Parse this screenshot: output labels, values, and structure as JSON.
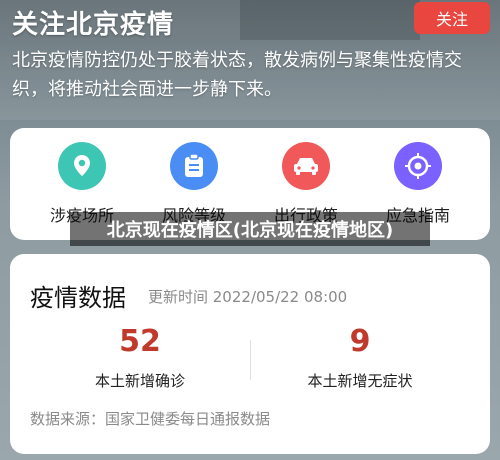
{
  "header": {
    "title": "关注北京疫情",
    "follow_button": "关注",
    "description": "北京疫情防控仍处于胶着状态，散发病例与聚集性疫情交织，将推动社会面进一步静下来。"
  },
  "quick_links": [
    {
      "label": "涉疫场所",
      "icon": "location-pin-icon",
      "color": "#3ec6b4"
    },
    {
      "label": "风险等级",
      "icon": "clipboard-icon",
      "color": "#4a8ef5"
    },
    {
      "label": "出行政策",
      "icon": "car-icon",
      "color": "#f0585a"
    },
    {
      "label": "应急指南",
      "icon": "target-icon",
      "color": "#7b61ff"
    }
  ],
  "caption": "北京现在疫情区(北京现在疫情地区)",
  "epidemic_data": {
    "title": "疫情数据",
    "update_time": "更新时间 2022/05/22 08:00",
    "stats": [
      {
        "value": "52",
        "label": "本土新增确诊"
      },
      {
        "value": "9",
        "label": "本土新增无症状"
      }
    ],
    "source": "数据来源：国家卫健委每日通报数据",
    "accent_color": "#c0392b"
  }
}
